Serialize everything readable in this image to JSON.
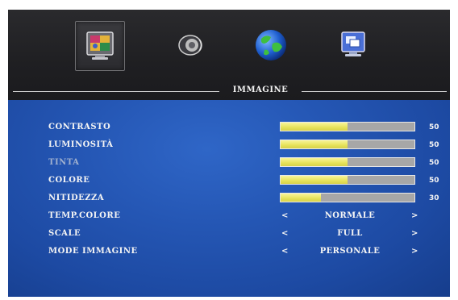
{
  "menu": {
    "tabs": [
      {
        "id": "picture",
        "icon": "monitor-picture-icon",
        "selected": true
      },
      {
        "id": "sound",
        "icon": "speaker-icon",
        "selected": false
      },
      {
        "id": "network",
        "icon": "globe-icon",
        "selected": false
      },
      {
        "id": "pc",
        "icon": "pc-windows-icon",
        "selected": false
      }
    ],
    "section_title": "IMMAGINE"
  },
  "settings": {
    "sliders": [
      {
        "label": "CONTRASTO",
        "value": 50,
        "value_text": "50",
        "max": 100,
        "dimmed": false
      },
      {
        "label": "LUMINOSITÀ",
        "value": 50,
        "value_text": "50",
        "max": 100,
        "dimmed": false
      },
      {
        "label": "TINTA",
        "value": 50,
        "value_text": "50",
        "max": 100,
        "dimmed": true
      },
      {
        "label": "COLORE",
        "value": 50,
        "value_text": "50",
        "max": 100,
        "dimmed": false
      },
      {
        "label": "NITIDEZZA",
        "value": 30,
        "value_text": "30",
        "max": 100,
        "dimmed": false
      }
    ],
    "options": [
      {
        "label": "TEMP.COLORE",
        "value": "NORMALE",
        "left_arrow": "<",
        "right_arrow": ">"
      },
      {
        "label": "SCALE",
        "value": "FULL",
        "left_arrow": "<",
        "right_arrow": ">"
      },
      {
        "label": "MODE IMMAGINE",
        "value": "PERSONALE",
        "left_arrow": "<",
        "right_arrow": ">"
      }
    ]
  },
  "colors": {
    "panel_blue": "#2557b5",
    "bar_fill": "#e6e25a",
    "bar_track": "#a7a7a7",
    "topbar": "#1f1f22"
  }
}
